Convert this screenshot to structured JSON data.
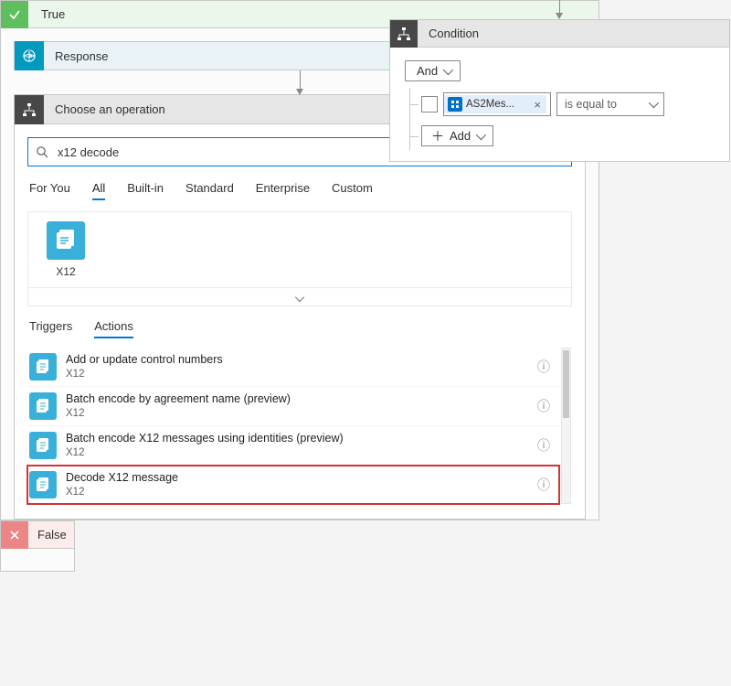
{
  "condition": {
    "title": "Condition",
    "logic_label": "And",
    "token_label": "AS2Mes...",
    "operator_label": "is equal to",
    "add_label": "Add"
  },
  "true_panel": {
    "label": "True"
  },
  "false_panel": {
    "label": "False"
  },
  "response": {
    "label": "Response"
  },
  "choose_op": {
    "title": "Choose an operation",
    "search_value": "x12 decode",
    "filter_tabs": [
      "For You",
      "All",
      "Built-in",
      "Standard",
      "Enterprise",
      "Custom"
    ],
    "active_filter": 1,
    "connector": {
      "name": "X12"
    },
    "ta_tabs": [
      "Triggers",
      "Actions"
    ],
    "active_ta": 1,
    "actions": [
      {
        "title": "Add or update control numbers",
        "subtitle": "X12"
      },
      {
        "title": "Batch encode by agreement name (preview)",
        "subtitle": "X12"
      },
      {
        "title": "Batch encode X12 messages using identities (preview)",
        "subtitle": "X12"
      },
      {
        "title": "Decode X12 message",
        "subtitle": "X12",
        "highlight": true
      }
    ]
  }
}
